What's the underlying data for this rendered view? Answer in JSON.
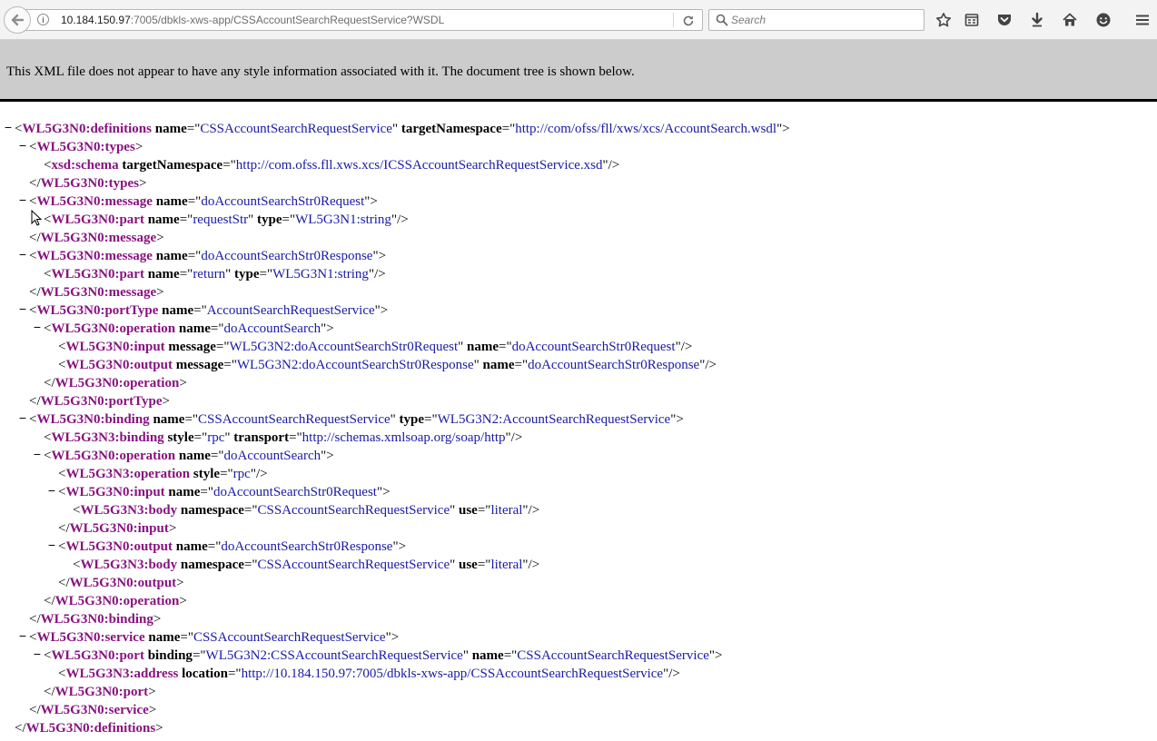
{
  "browser": {
    "url_host": "10.184.150.97",
    "url_rest": ":7005/dbkls-xws-app/CSSAccountSearchRequestService?WSDL",
    "search_placeholder": "Search",
    "icons": [
      "back-arrow-icon",
      "info-icon",
      "reload-icon",
      "search-icon",
      "bookmark-star-icon",
      "reading-list-icon",
      "pocket-icon",
      "download-arrow-icon",
      "home-icon",
      "hello-smiley-icon",
      "hamburger-menu-icon"
    ]
  },
  "banner": {
    "text": "This XML file does not appear to have any style information associated with it. The document tree is shown below."
  },
  "xml_lines": [
    {
      "d": 0,
      "t": true,
      "close": false,
      "tag": "WL5G3N0:definitions",
      "attrs": [
        {
          "n": "name",
          "v": "CSSAccountSearchRequestService"
        },
        {
          "n": "targetNamespace",
          "v": "http://com/ofss/fll/xws/xcs/AccountSearch.wsdl"
        }
      ],
      "end": ">"
    },
    {
      "d": 1,
      "t": true,
      "close": false,
      "tag": "WL5G3N0:types",
      "attrs": [],
      "end": ">"
    },
    {
      "d": 2,
      "t": false,
      "close": false,
      "tag": "xsd:schema",
      "attrs": [
        {
          "n": "targetNamespace",
          "v": "http://com.ofss.fll.xws.xcs/ICSSAccountSearchRequestService.xsd"
        }
      ],
      "end": "/>"
    },
    {
      "d": 1,
      "t": false,
      "close": true,
      "tag": "WL5G3N0:types",
      "attrs": [],
      "end": ">"
    },
    {
      "d": 1,
      "t": true,
      "close": false,
      "tag": "WL5G3N0:message",
      "attrs": [
        {
          "n": "name",
          "v": "doAccountSearchStr0Request"
        }
      ],
      "end": ">"
    },
    {
      "d": 2,
      "t": false,
      "close": false,
      "tag": "WL5G3N0:part",
      "attrs": [
        {
          "n": "name",
          "v": "requestStr"
        },
        {
          "n": "type",
          "v": "WL5G3N1:string"
        }
      ],
      "end": "/>"
    },
    {
      "d": 1,
      "t": false,
      "close": true,
      "tag": "WL5G3N0:message",
      "attrs": [],
      "end": ">"
    },
    {
      "d": 1,
      "t": true,
      "close": false,
      "tag": "WL5G3N0:message",
      "attrs": [
        {
          "n": "name",
          "v": "doAccountSearchStr0Response"
        }
      ],
      "end": ">"
    },
    {
      "d": 2,
      "t": false,
      "close": false,
      "tag": "WL5G3N0:part",
      "attrs": [
        {
          "n": "name",
          "v": "return"
        },
        {
          "n": "type",
          "v": "WL5G3N1:string"
        }
      ],
      "end": "/>"
    },
    {
      "d": 1,
      "t": false,
      "close": true,
      "tag": "WL5G3N0:message",
      "attrs": [],
      "end": ">"
    },
    {
      "d": 1,
      "t": true,
      "close": false,
      "tag": "WL5G3N0:portType",
      "attrs": [
        {
          "n": "name",
          "v": "AccountSearchRequestService"
        }
      ],
      "end": ">"
    },
    {
      "d": 2,
      "t": true,
      "close": false,
      "tag": "WL5G3N0:operation",
      "attrs": [
        {
          "n": "name",
          "v": "doAccountSearch"
        }
      ],
      "end": ">"
    },
    {
      "d": 3,
      "t": false,
      "close": false,
      "tag": "WL5G3N0:input",
      "attrs": [
        {
          "n": "message",
          "v": "WL5G3N2:doAccountSearchStr0Request"
        },
        {
          "n": "name",
          "v": "doAccountSearchStr0Request"
        }
      ],
      "end": "/>"
    },
    {
      "d": 3,
      "t": false,
      "close": false,
      "tag": "WL5G3N0:output",
      "attrs": [
        {
          "n": "message",
          "v": "WL5G3N2:doAccountSearchStr0Response"
        },
        {
          "n": "name",
          "v": "doAccountSearchStr0Response"
        }
      ],
      "end": "/>"
    },
    {
      "d": 2,
      "t": false,
      "close": true,
      "tag": "WL5G3N0:operation",
      "attrs": [],
      "end": ">"
    },
    {
      "d": 1,
      "t": false,
      "close": true,
      "tag": "WL5G3N0:portType",
      "attrs": [],
      "end": ">"
    },
    {
      "d": 1,
      "t": true,
      "close": false,
      "tag": "WL5G3N0:binding",
      "attrs": [
        {
          "n": "name",
          "v": "CSSAccountSearchRequestService"
        },
        {
          "n": "type",
          "v": "WL5G3N2:AccountSearchRequestService"
        }
      ],
      "end": ">"
    },
    {
      "d": 2,
      "t": false,
      "close": false,
      "tag": "WL5G3N3:binding",
      "attrs": [
        {
          "n": "style",
          "v": "rpc"
        },
        {
          "n": "transport",
          "v": "http://schemas.xmlsoap.org/soap/http"
        }
      ],
      "end": "/>"
    },
    {
      "d": 2,
      "t": true,
      "close": false,
      "tag": "WL5G3N0:operation",
      "attrs": [
        {
          "n": "name",
          "v": "doAccountSearch"
        }
      ],
      "end": ">"
    },
    {
      "d": 3,
      "t": false,
      "close": false,
      "tag": "WL5G3N3:operation",
      "attrs": [
        {
          "n": "style",
          "v": "rpc"
        }
      ],
      "end": "/>"
    },
    {
      "d": 3,
      "t": true,
      "close": false,
      "tag": "WL5G3N0:input",
      "attrs": [
        {
          "n": "name",
          "v": "doAccountSearchStr0Request"
        }
      ],
      "end": ">"
    },
    {
      "d": 4,
      "t": false,
      "close": false,
      "tag": "WL5G3N3:body",
      "attrs": [
        {
          "n": "namespace",
          "v": "CSSAccountSearchRequestService"
        },
        {
          "n": "use",
          "v": "literal"
        }
      ],
      "end": "/>"
    },
    {
      "d": 3,
      "t": false,
      "close": true,
      "tag": "WL5G3N0:input",
      "attrs": [],
      "end": ">"
    },
    {
      "d": 3,
      "t": true,
      "close": false,
      "tag": "WL5G3N0:output",
      "attrs": [
        {
          "n": "name",
          "v": "doAccountSearchStr0Response"
        }
      ],
      "end": ">"
    },
    {
      "d": 4,
      "t": false,
      "close": false,
      "tag": "WL5G3N3:body",
      "attrs": [
        {
          "n": "namespace",
          "v": "CSSAccountSearchRequestService"
        },
        {
          "n": "use",
          "v": "literal"
        }
      ],
      "end": "/>"
    },
    {
      "d": 3,
      "t": false,
      "close": true,
      "tag": "WL5G3N0:output",
      "attrs": [],
      "end": ">"
    },
    {
      "d": 2,
      "t": false,
      "close": true,
      "tag": "WL5G3N0:operation",
      "attrs": [],
      "end": ">"
    },
    {
      "d": 1,
      "t": false,
      "close": true,
      "tag": "WL5G3N0:binding",
      "attrs": [],
      "end": ">"
    },
    {
      "d": 1,
      "t": true,
      "close": false,
      "tag": "WL5G3N0:service",
      "attrs": [
        {
          "n": "name",
          "v": "CSSAccountSearchRequestService"
        }
      ],
      "end": ">"
    },
    {
      "d": 2,
      "t": true,
      "close": false,
      "tag": "WL5G3N0:port",
      "attrs": [
        {
          "n": "binding",
          "v": "WL5G3N2:CSSAccountSearchRequestService"
        },
        {
          "n": "name",
          "v": "CSSAccountSearchRequestService"
        }
      ],
      "end": ">"
    },
    {
      "d": 3,
      "t": false,
      "close": false,
      "tag": "WL5G3N3:address",
      "attrs": [
        {
          "n": "location",
          "v": "http://10.184.150.97:7005/dbkls-xws-app/CSSAccountSearchRequestService"
        }
      ],
      "end": "/>"
    },
    {
      "d": 2,
      "t": false,
      "close": true,
      "tag": "WL5G3N0:port",
      "attrs": [],
      "end": ">"
    },
    {
      "d": 1,
      "t": false,
      "close": true,
      "tag": "WL5G3N0:service",
      "attrs": [],
      "end": ">"
    },
    {
      "d": 0,
      "t": false,
      "close": true,
      "tag": "WL5G3N0:definitions",
      "attrs": [],
      "end": ">"
    }
  ]
}
